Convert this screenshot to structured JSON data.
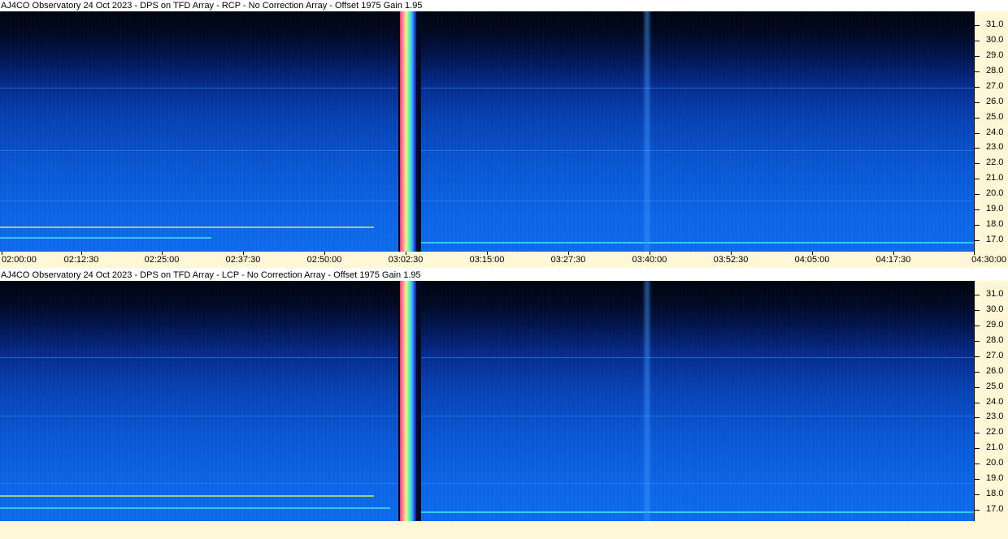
{
  "panels": [
    {
      "title": "AJ4CO Observatory 24 Oct 2023 - DPS on TFD Array  - RCP  -  No Correction Array  -  Offset 1975  Gain 1.95",
      "polarization": "RCP"
    },
    {
      "title": "AJ4CO Observatory 24 Oct 2023 - DPS on TFD Array  - LCP  -  No Correction Array  -  Offset 1975  Gain 1.95",
      "polarization": "LCP"
    }
  ],
  "chart_data": {
    "type": "heatmap",
    "x_tick_labels": [
      "02:00:00",
      "02:12:30",
      "02:25:00",
      "02:37:30",
      "02:50:00",
      "03:02:30",
      "03:15:00",
      "03:27:30",
      "03:40:00",
      "03:52:30",
      "04:05:00",
      "04:17:30",
      "04:30:00"
    ],
    "y_tick_labels": [
      "31.0",
      "30.0",
      "29.0",
      "28.0",
      "27.0",
      "26.0",
      "25.0",
      "24.0",
      "23.0",
      "22.0",
      "21.0",
      "20.0",
      "19.0",
      "18.0",
      "17.0"
    ],
    "y_values": [
      31.0,
      30.0,
      29.0,
      28.0,
      27.0,
      26.0,
      25.0,
      24.0,
      23.0,
      22.0,
      21.0,
      20.0,
      19.0,
      18.0,
      17.0
    ],
    "ylim": [
      16.4,
      31.8
    ],
    "xlim": [
      "02:00:00",
      "04:30:00"
    ],
    "features": [
      {
        "type": "broadband burst",
        "time": "03:02:30"
      },
      {
        "type": "vertical streak",
        "time": "03:39:45"
      }
    ],
    "colormap": [
      "#000410",
      "#021245",
      "#0742b5",
      "#0c66e8",
      "#44e0ff",
      "#b8f060",
      "#ff3040"
    ]
  }
}
